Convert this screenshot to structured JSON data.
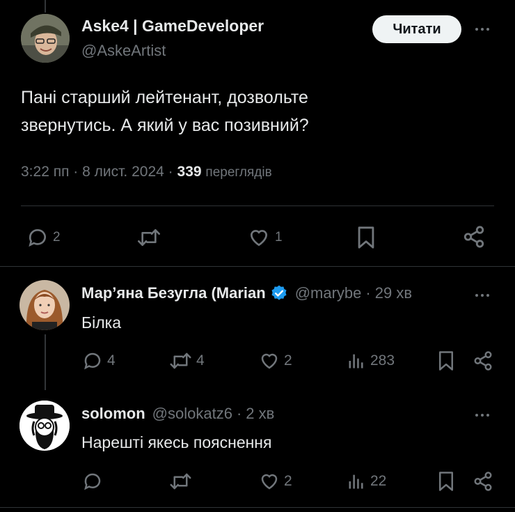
{
  "main_tweet": {
    "author_name": "Aske4 | GameDeveloper",
    "author_handle": "@AskeArtist",
    "follow_label": "Читати",
    "text_line1": "Пані старший лейтенант, дозвольте",
    "text_line2": "звернутись. А який у вас позивний?",
    "time": "3:22 пп",
    "date": "8 лист. 2024",
    "sep": "·",
    "views_count": "339",
    "views_label": "переглядів",
    "actions": {
      "replies": "2",
      "retweets": "",
      "likes": "1"
    }
  },
  "replies": [
    {
      "author_name": "Мар’яна Безугла (Marian",
      "author_handle": "@marybe",
      "sep": "·",
      "time": "29 хв",
      "verified": true,
      "text": "Білка",
      "actions": {
        "replies": "4",
        "retweets": "4",
        "likes": "2",
        "views": "283"
      }
    },
    {
      "author_name": "solomon",
      "author_handle": "@solokatz6",
      "sep": "·",
      "time": "2 хв",
      "verified": false,
      "text": "Нарешті якесь пояснення",
      "actions": {
        "replies": "",
        "retweets": "",
        "likes": "2",
        "views": "22"
      }
    }
  ],
  "colors": {
    "background": "#000000",
    "text": "#e7e9ea",
    "muted": "#71767b",
    "verified_blue": "#1d9bf0",
    "follow_button_bg": "#eff3f4"
  },
  "icons": [
    "reply-icon",
    "retweet-icon",
    "like-icon",
    "bookmark-icon",
    "share-icon",
    "views-icon",
    "more-icon",
    "verified-badge-icon"
  ]
}
